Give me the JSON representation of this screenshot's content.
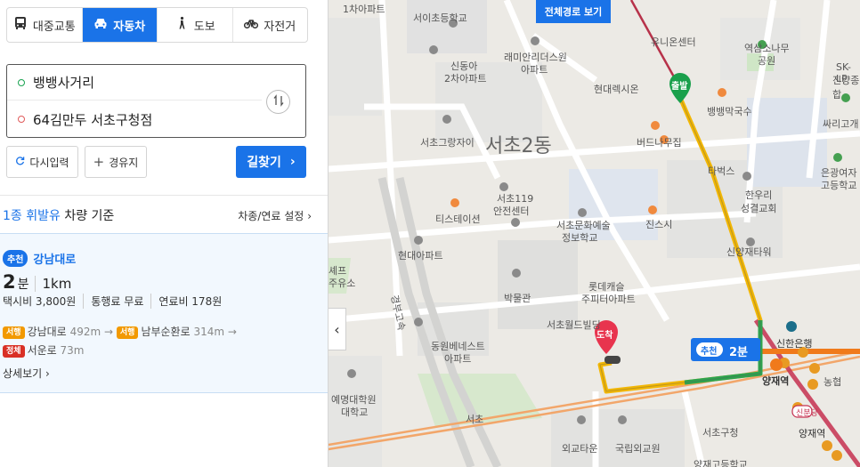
{
  "transport_tabs": [
    {
      "label": "대중교통",
      "icon": "bus-icon"
    },
    {
      "label": "자동차",
      "icon": "car-icon",
      "active": true
    },
    {
      "label": "도보",
      "icon": "walk-icon"
    },
    {
      "label": "자전거",
      "icon": "bicycle-icon"
    }
  ],
  "route_inputs": {
    "origin": "뱅뱅사거리",
    "destination": "64김만두 서초구청점"
  },
  "buttons": {
    "reset": "다시입력",
    "waypoint": "경유지",
    "find": "길찾기"
  },
  "criteria": {
    "fuel": "1종 휘발유",
    "suffix": " 차량 기준",
    "vehicle_settings": "차종/연료 설정"
  },
  "route": {
    "badge": "추천",
    "name": "강남대로",
    "time_value": "2",
    "time_unit": "분",
    "distance": "1km",
    "taxi": "택시비 3,800원",
    "toll": "통행료 무료",
    "fuel_cost": "연료비 178원",
    "roads": [
      {
        "badge": "서행",
        "name": "강남대로",
        "dist": "492m",
        "color": "#f29900"
      },
      {
        "badge": "서행",
        "name": "남부순환로",
        "dist": "314m",
        "color": "#f29900"
      },
      {
        "badge": "정체",
        "name": "서운로",
        "dist": "73m",
        "color": "#d93025"
      }
    ],
    "detail": "상세보기"
  },
  "map": {
    "full_route_button": "전체경로 보기",
    "start_label": "출발",
    "end_label": "도착",
    "callout_badge": "추천",
    "callout_time": "2분",
    "district_label": "서초2동",
    "labels": [
      "1차아파트",
      "서이초등학교",
      "래미안리더스원",
      "아파트",
      "신동아",
      "2차아파트",
      "서초그랑자이",
      "유니온센터",
      "역삼소나무",
      "공원",
      "SK-LP",
      "진양종합",
      "현대렉시온",
      "뱅뱅막국수",
      "싸리고개",
      "버드나무집",
      "타벅스",
      "한우리",
      "성결교회",
      "은광여자",
      "고등학교",
      "서초119",
      "안전센터",
      "티스테이션",
      "서초문화예술",
      "정보학교",
      "진스시",
      "현대아파트",
      "신양재타워",
      "롯데캐슬",
      "주피터아파트",
      "박물관",
      "서초월드빌딩",
      "동원베네스트",
      "아파트",
      "경부고속",
      "신한은행",
      "양재역",
      "농협",
      "신분당",
      "양재역",
      "예명대학원",
      "대학교",
      "서초",
      "외교타운",
      "국립외교원",
      "서초구청",
      "양재고등학교",
      "셰프",
      "주유소"
    ]
  },
  "colors": {
    "accent": "#1a73e8",
    "route_yellow": "#f2b705",
    "route_green": "#2ea44f",
    "start_green": "#1aa04c",
    "end_red": "#e8344e"
  }
}
